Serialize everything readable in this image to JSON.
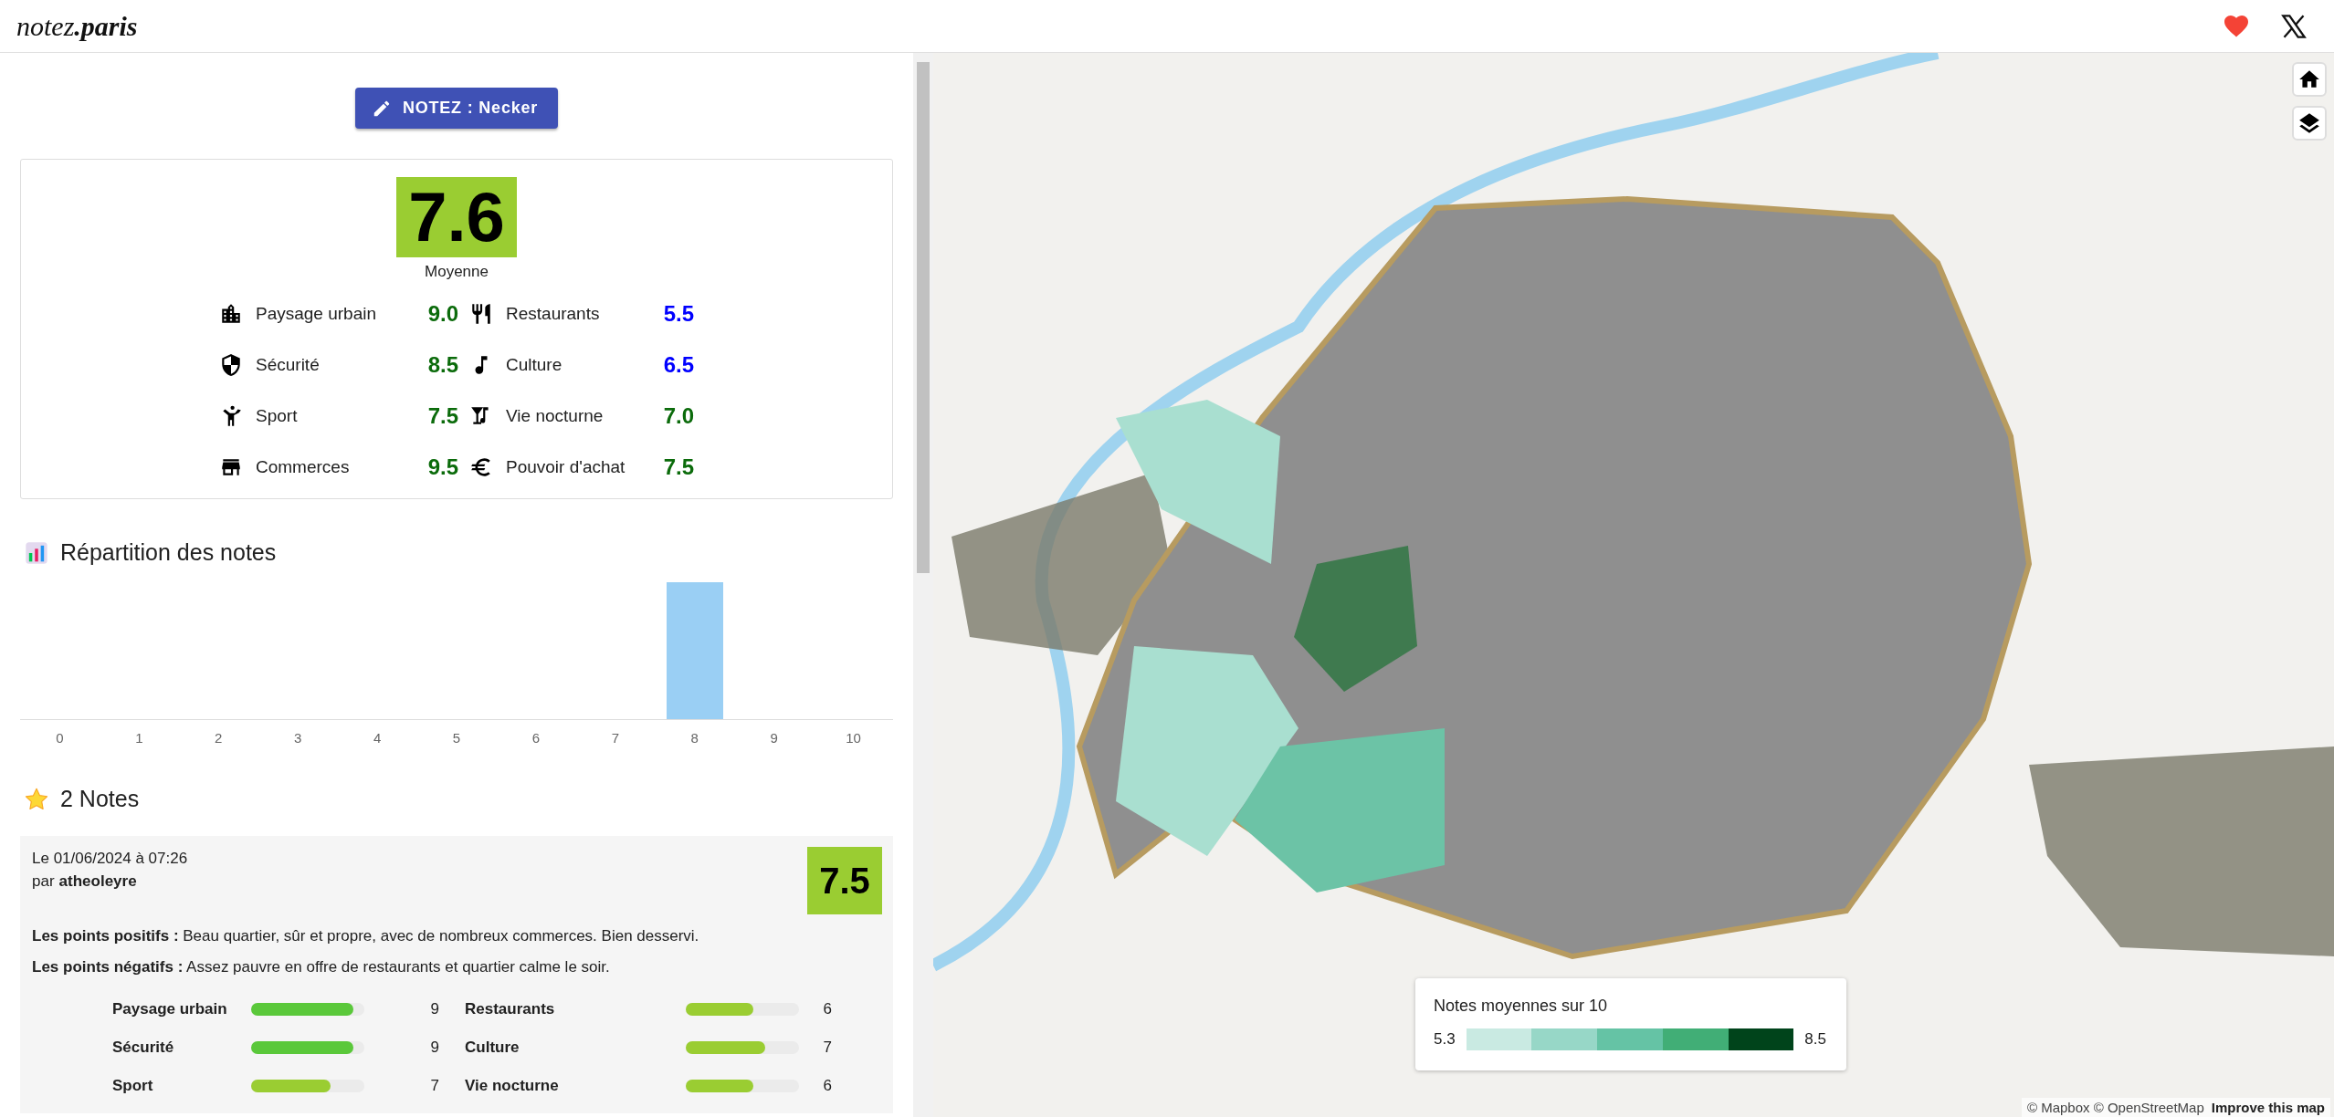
{
  "header": {
    "logo": "notez**.paris**"
  },
  "rate_button": {
    "label": "NOTEZ : Necker"
  },
  "summary": {
    "score": "7.6",
    "score_label": "Moyenne",
    "ratings": [
      {
        "label": "Paysage urbain",
        "value": "9.0",
        "color": "#0b6b0b"
      },
      {
        "label": "Restaurants",
        "value": "5.5",
        "color": "#0000ff"
      },
      {
        "label": "Sécurité",
        "value": "8.5",
        "color": "#0b6b0b"
      },
      {
        "label": "Culture",
        "value": "6.5",
        "color": "#0000ff"
      },
      {
        "label": "Sport",
        "value": "7.5",
        "color": "#0b6b0b"
      },
      {
        "label": "Vie nocturne",
        "value": "7.0",
        "color": "#0b6b0b"
      },
      {
        "label": "Commerces",
        "value": "9.5",
        "color": "#0b6b0b"
      },
      {
        "label": "Pouvoir d'achat",
        "value": "7.5",
        "color": "#0b6b0b"
      }
    ]
  },
  "distribution": {
    "title": "Répartition des notes",
    "bins": [
      {
        "label": "0",
        "filled": false
      },
      {
        "label": "1",
        "filled": false
      },
      {
        "label": "2",
        "filled": false
      },
      {
        "label": "3",
        "filled": false
      },
      {
        "label": "4",
        "filled": false
      },
      {
        "label": "5",
        "filled": false
      },
      {
        "label": "6",
        "filled": false
      },
      {
        "label": "7",
        "filled": false
      },
      {
        "label": "8",
        "filled": true
      },
      {
        "label": "9",
        "filled": false
      },
      {
        "label": "10",
        "filled": false
      }
    ]
  },
  "notes": {
    "title": "2 Notes",
    "items": [
      {
        "date": "Le 01/06/2024 à 07:26",
        "author_prefix": "par",
        "author": "atheoleyre",
        "score": "7.5",
        "positive": "**Les points positifs :** Beau quartier, sûr et propre, avec de nombreux commerces. Bien desservi.",
        "negative": "**Les points négatifs :** Assez pauvre en offre de restaurants et quartier calme le soir.",
        "ratings": [
          {
            "label": "Paysage urbain",
            "level": 0.9,
            "value": "9"
          },
          {
            "label": "Restaurants",
            "level": 0.6,
            "value": "6"
          },
          {
            "label": "Sécurité",
            "level": 0.9,
            "value": "9"
          },
          {
            "label": "Culture",
            "level": 0.7,
            "value": "7"
          },
          {
            "label": "Sport",
            "level": 0.7,
            "value": "7"
          },
          {
            "label": "Vie nocturne",
            "level": 0.6,
            "value": "6"
          }
        ]
      }
    ]
  },
  "map": {
    "legend": {
      "title": "Notes moyennes sur 10",
      "min": "5.3",
      "max": "8.5",
      "steps": [
        {
          "color": "#c9eae2"
        },
        {
          "color": "#97d7c7"
        },
        {
          "color": "#65c3a5"
        },
        {
          "color": "#41ae76"
        },
        {
          "color": "#00441b"
        }
      ]
    },
    "attribution": "© Mapbox © OpenStreetMap",
    "improve_link": "Improve this map"
  }
}
